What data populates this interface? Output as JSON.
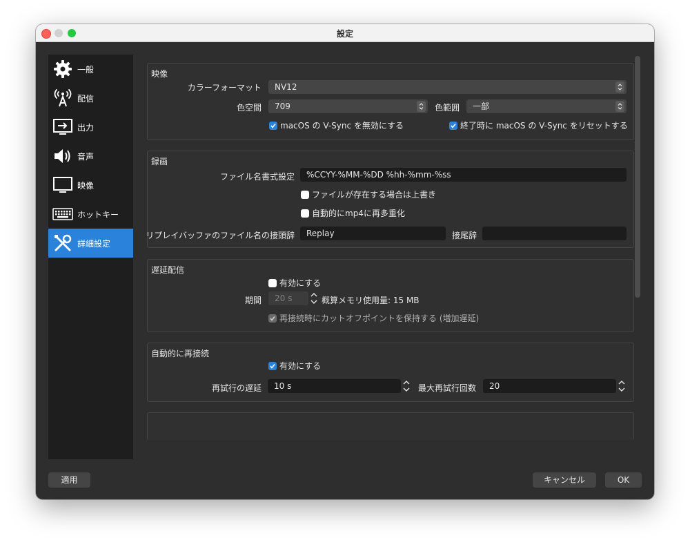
{
  "window": {
    "title": "設定"
  },
  "sidebar": {
    "items": [
      {
        "label": "一般",
        "icon": "gear-icon"
      },
      {
        "label": "配信",
        "icon": "broadcast-antenna-icon"
      },
      {
        "label": "出力",
        "icon": "output-monitor-icon"
      },
      {
        "label": "音声",
        "icon": "speaker-icon"
      },
      {
        "label": "映像",
        "icon": "monitor-icon"
      },
      {
        "label": "ホットキー",
        "icon": "keyboard-icon"
      },
      {
        "label": "詳細設定",
        "icon": "tools-icon",
        "active": true
      }
    ]
  },
  "video": {
    "title": "映像",
    "color_format_label": "カラーフォーマット",
    "color_format_value": "NV12",
    "color_space_label": "色空間",
    "color_space_value": "709",
    "color_range_label": "色範囲",
    "color_range_value": "一部",
    "disable_vsync_label": "macOS の V-Sync を無効にする",
    "disable_vsync_checked": true,
    "reset_vsync_label": "終了時に macOS の V-Sync をリセットする",
    "reset_vsync_checked": true
  },
  "recording": {
    "title": "録画",
    "filename_format_label": "ファイル名書式設定",
    "filename_format_value": "%CCYY-%MM-%DD %hh-%mm-%ss",
    "overwrite_label": "ファイルが存在する場合は上書き",
    "overwrite_checked": false,
    "remux_label": "自動的にmp4に再多重化",
    "remux_checked": false,
    "replay_prefix_label": "リプレイバッファのファイル名の接頭辞",
    "replay_prefix_value": "Replay",
    "suffix_label": "接尾辞",
    "suffix_value": ""
  },
  "delay": {
    "title": "遅延配信",
    "enable_label": "有効にする",
    "enable_checked": false,
    "duration_label": "期間",
    "duration_value": "20 s",
    "memory_text": "概算メモリ使用量: 15 MB",
    "preserve_label": "再接続時にカットオフポイントを保持する (増加遅延)",
    "preserve_checked": true
  },
  "reconnect": {
    "title": "自動的に再接続",
    "enable_label": "有効にする",
    "enable_checked": true,
    "retry_delay_label": "再試行の遅延",
    "retry_delay_value": "10 s",
    "max_retries_label": "最大再試行回数",
    "max_retries_value": "20"
  },
  "footer": {
    "apply_label": "適用",
    "cancel_label": "キャンセル",
    "ok_label": "OK"
  },
  "colors": {
    "accent": "#2a82da",
    "window_bg": "#2e2e2e",
    "sidebar_bg": "#1e1e1e"
  }
}
